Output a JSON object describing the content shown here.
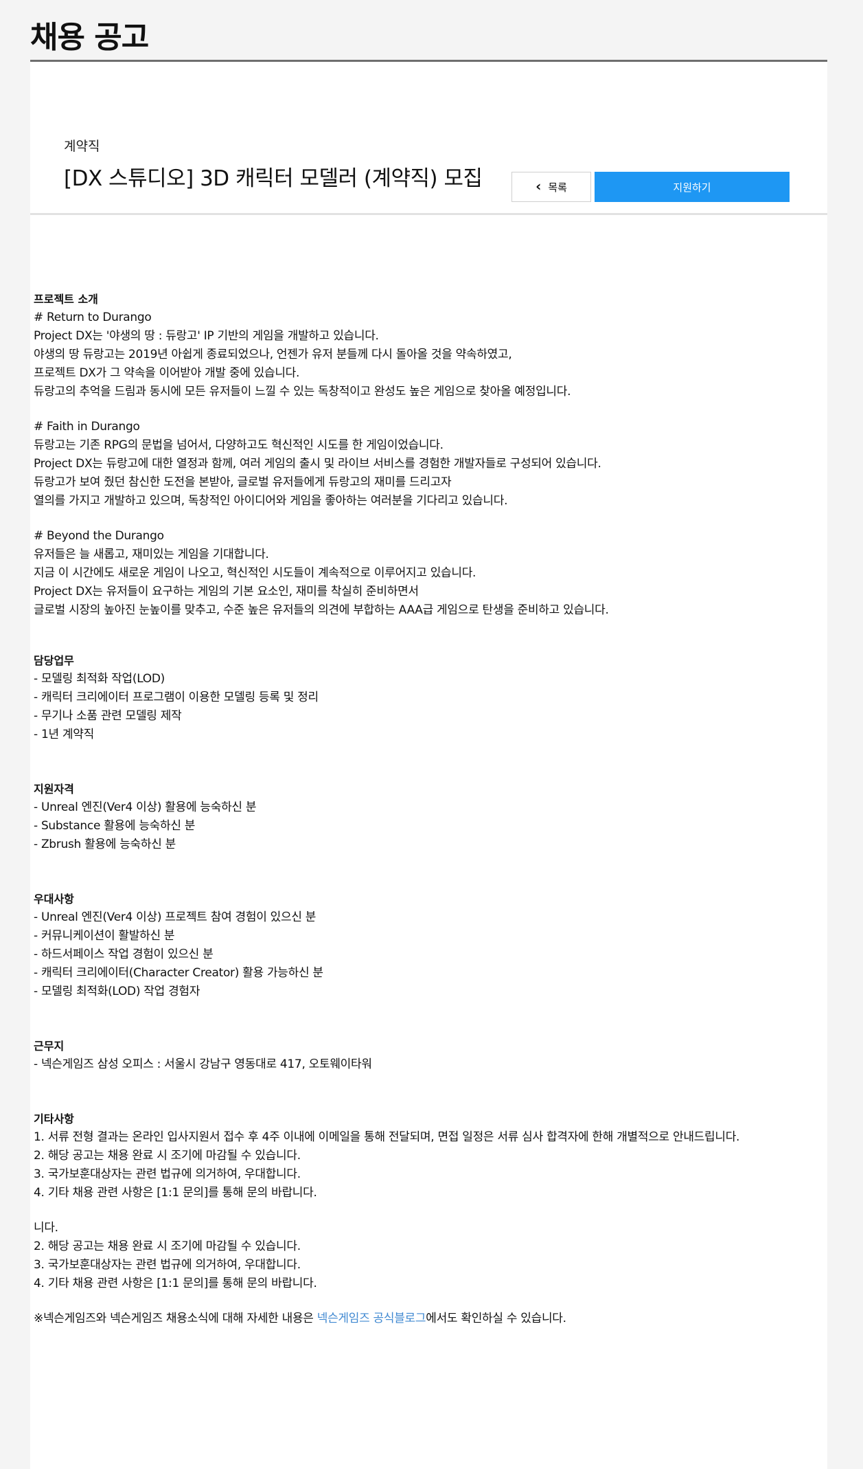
{
  "page": {
    "title": "채용 공고"
  },
  "job": {
    "category": "계약직",
    "title": "[DX 스튜디오] 3D 캐릭터 모델러 (계약직) 모집"
  },
  "actions": {
    "list_label": "목록",
    "list_icon": "chevron-left-icon",
    "apply_label": "지원하기",
    "apply_color": "#1e97f3"
  },
  "sections": {
    "project": {
      "heading": "프로젝트 소개",
      "p1": [
        "# Return to Durango",
        "Project DX는 '야생의 땅 : 듀랑고' IP 기반의 게임을 개발하고 있습니다.",
        "야생의 땅 듀랑고는 2019년 아쉽게 종료되었으나, 언젠가 유저 분들께 다시 돌아올 것을 약속하였고,",
        "프로젝트 DX가 그 약속을 이어받아 개발 중에 있습니다.",
        "듀랑고의 추억을 드림과 동시에 모든 유저들이 느낄 수 있는 독창적이고 완성도 높은 게임으로 찾아올 예정입니다."
      ],
      "p2": [
        "# Faith in Durango",
        "듀랑고는 기존 RPG의 문법을 넘어서, 다양하고도 혁신적인 시도를 한 게임이었습니다.",
        "Project DX는 듀랑고에 대한 열정과 함께, 여러 게임의 출시 및 라이브 서비스를 경험한 개발자들로 구성되어 있습니다.",
        "듀랑고가 보여 줬던 참신한 도전을 본받아, 글로벌 유저들에게 듀랑고의 재미를 드리고자",
        "열의를 가지고 개발하고 있으며, 독창적인 아이디어와 게임을 좋아하는 여러분을 기다리고 있습니다."
      ],
      "p3": [
        "# Beyond the Durango",
        "유저들은 늘 새롭고, 재미있는 게임을 기대합니다.",
        "지금 이 시간에도 새로운 게임이 나오고, 혁신적인 시도들이 계속적으로 이루어지고 있습니다.",
        "Project DX는 유저들이 요구하는 게임의 기본 요소인, 재미를 착실히 준비하면서",
        "글로벌 시장의 높아진 눈높이를 맞추고, 수준 높은 유저들의 의견에 부합하는 AAA급 게임으로 탄생을 준비하고 있습니다."
      ]
    },
    "duties": {
      "heading": "담당업무",
      "items": [
        "- 모델링 최적화 작업(LOD)",
        "- 캐릭터 크리에이터 프로그램이 이용한 모델링 등록 및 정리",
        "- 무기나 소품 관련 모델링 제작",
        "- 1년 계약직"
      ]
    },
    "qualifications": {
      "heading": "지원자격",
      "items": [
        "- Unreal 엔진(Ver4 이상) 활용에 능숙하신 분",
        "- Substance 활용에 능숙하신 분",
        "- Zbrush 활용에 능숙하신 분"
      ]
    },
    "preferred": {
      "heading": "우대사항",
      "items": [
        "- Unreal 엔진(Ver4 이상) 프로젝트 참여 경험이 있으신 분",
        "- 커뮤니케이션이 활발하신 분",
        "- 하드서페이스 작업 경험이 있으신 분",
        "- 캐릭터 크리에이터(Character Creator) 활용 가능하신 분",
        "- 모델링 최적화(LOD) 작업 경험자"
      ]
    },
    "location": {
      "heading": "근무지",
      "items": [
        "- 넥슨게임즈 삼성 오피스 : 서울시 강남구 영동대로 417, 오토웨이타워"
      ]
    },
    "etc": {
      "heading": "기타사항",
      "item1": "1. 서류 전형 결과는 온라인 입사지원서 접수 후 4주 이내에 이메일을 통해 전달되며, 면접 일정은 서류 심사 합격자에 한해 개별적으로 안내드립니다.",
      "items_a": [
        "2. 해당 공고는 채용 완료 시 조기에 마감될 수 있습니다.",
        "3. 국가보훈대상자는 관련 법규에 의거하여, 우대합니다.",
        "4. 기타 채용 관련 사항은 [1:1 문의]를 통해 문의 바랍니다."
      ],
      "items_b": [
        "니다.",
        "2. 해당 공고는 채용 완료 시 조기에 마감될 수 있습니다.",
        "3. 국가보훈대상자는 관련 법규에 의거하여, 우대합니다.",
        "4. 기타 채용 관련 사항은 [1:1 문의]를 통해 문의 바랍니다."
      ],
      "footer_prefix": "※넥슨게임즈와 넥슨게임즈 채용소식에 대해 자세한 내용은 ",
      "footer_link": "넥슨게임즈 공식블로그",
      "footer_suffix": "에서도 확인하실 수 있습니다."
    }
  }
}
